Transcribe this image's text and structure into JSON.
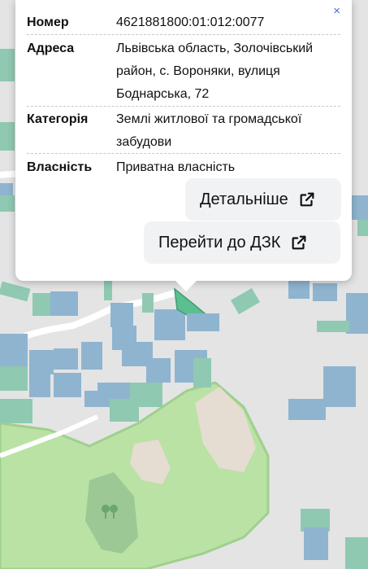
{
  "popup": {
    "close_glyph": "×",
    "rows": [
      {
        "key": "Номер",
        "value": "4621881800:01:012:0077"
      },
      {
        "key": "Адреса",
        "value": "Львівська область, Золочівський район, с. Вороняки, вулиця Боднарська, 72"
      },
      {
        "key": "Категорія",
        "value": "Землі житлової та громадської забудови"
      },
      {
        "key": "Власність",
        "value": "Приватна власність"
      }
    ],
    "details_button": "Детальніше",
    "dzk_button": "Перейти до ДЗК"
  },
  "colors": {
    "parcel_blue": "#8fb4cf",
    "parcel_teal": "#8cc9b2",
    "forest_green": "#b7e0a0",
    "forest_dark": "#9bc99a",
    "road": "#ffffff",
    "background": "#e4e4e4",
    "selected_parcel": "#5cbf8f"
  },
  "icons": [
    "close-icon",
    "external-link-icon",
    "tree-icon"
  ]
}
